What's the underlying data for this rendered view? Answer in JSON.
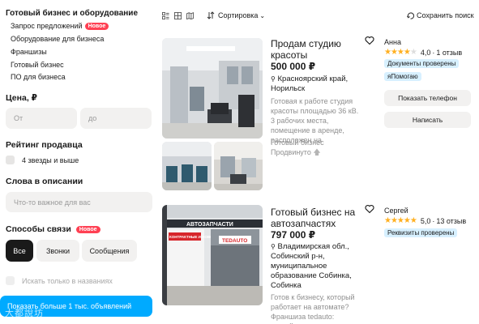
{
  "sidebar": {
    "category_title": "Готовый бизнес и оборудование",
    "categories": [
      {
        "label": "Запрос предложений",
        "badge": "Новое"
      },
      {
        "label": "Оборудование для бизнеса"
      },
      {
        "label": "Франшизы"
      },
      {
        "label": "Готовый бизнес"
      },
      {
        "label": "ПО для бизнеса"
      }
    ],
    "price": {
      "title": "Цена, ₽",
      "from_placeholder": "От",
      "to_placeholder": "до"
    },
    "seller_rating": {
      "title": "Рейтинг продавца",
      "option": "4 звезды и выше"
    },
    "keywords": {
      "title": "Слова в описании",
      "placeholder": "Что-то важное для вас"
    },
    "contact": {
      "title": "Способы связи",
      "badge": "Новое",
      "options": [
        "Все",
        "Звонки",
        "Сообщения"
      ],
      "selected": "Все"
    },
    "titles_only": "Искать только в названиях",
    "show_button": "Показать больше 1 тыс. объявлений",
    "watermark": "大都說坊"
  },
  "toolbar": {
    "sort_label": "Сортировка",
    "save_search": "Сохранить поиск"
  },
  "listings": [
    {
      "title": "Продам студию красоты",
      "price": "500 000 ₽",
      "location": "Красноярский край, Норильск",
      "description": "Готовая к работе студия красоты площадью 36 кВ. 3 рабочих места, помещение в аренде, расположен на",
      "category": "Готовый бизнес",
      "promoted": "Продвинуто",
      "seller": "Анна",
      "rating": "4,0",
      "reviews": "1 отзыв",
      "stars": 4,
      "tags": [
        "Документы проверены",
        "яПомогаю"
      ],
      "buttons": [
        "Показать телефон",
        "Написать"
      ]
    },
    {
      "title": "Готовый бизнес на автозапчастях",
      "price": "797 000 ₽",
      "location": "Владимирская обл., Собинский р-н, муниципальное образование Собинка, Собинка",
      "description": "Готов к бизнесу, который работает на автомате? Франшиза tedauto: откройте",
      "seller": "Сергей",
      "rating": "5,0",
      "reviews": "13 отзыв",
      "stars": 5,
      "tags": [
        "Реквизиты проверены"
      ],
      "store_sign": "АВТОЗАПЧАСТИ",
      "store_brand": "TEDAUTO",
      "store_banner": "КОНТРАКТНЫЕ И НОВЫЕ"
    }
  ],
  "colors": {
    "accent": "#00aaff",
    "badge": "#ff4053",
    "star": "#ffb021"
  }
}
